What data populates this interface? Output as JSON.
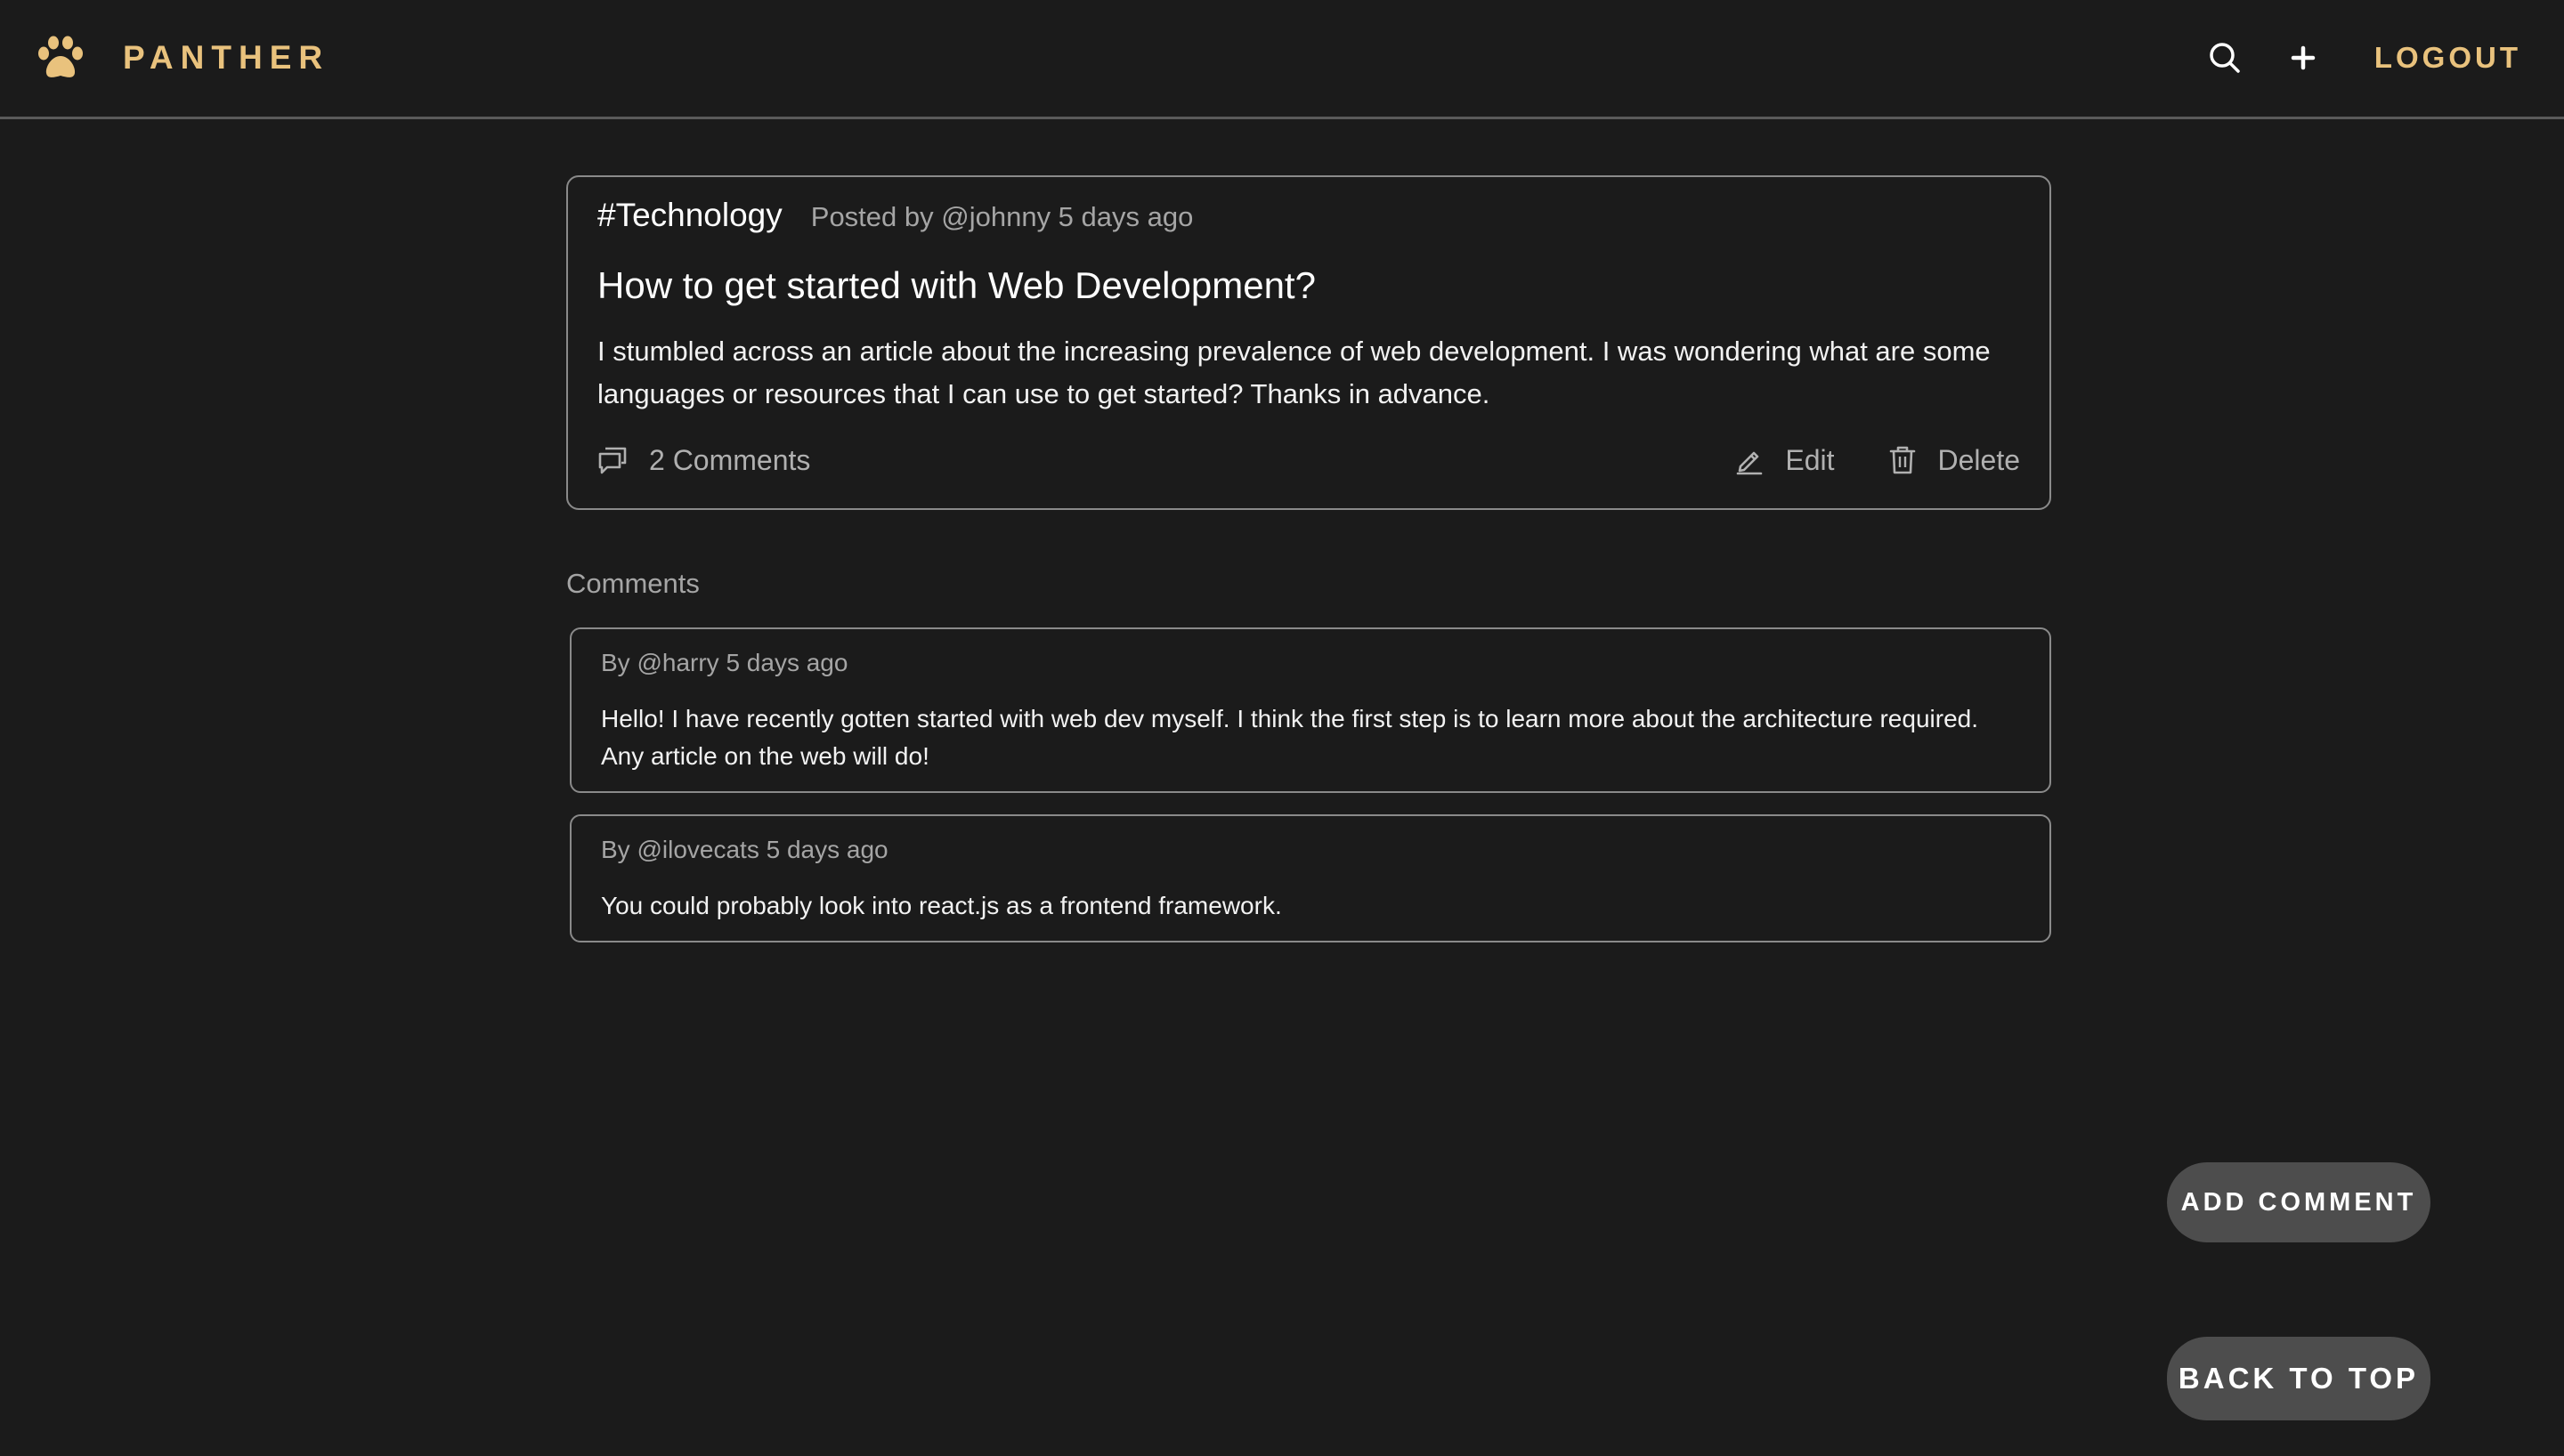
{
  "header": {
    "brand": "PANTHER",
    "logout_label": "LOGOUT",
    "accent_color": "#e9c27d",
    "icons": [
      "paw-icon",
      "search-icon",
      "plus-icon"
    ]
  },
  "post": {
    "tag": "#Technology",
    "posted_by": "Posted by @johnny 5 days ago",
    "title": "How to get started with Web Development?",
    "body": "I stumbled across an article about the increasing prevalence of web development. I was wondering what are some languages or resources that I can use to get started? Thanks in advance.",
    "comments_label": "2 Comments",
    "edit_label": "Edit",
    "delete_label": "Delete",
    "icons": [
      "comment-icon",
      "edit-icon",
      "trash-icon"
    ]
  },
  "comments_section": {
    "heading": "Comments",
    "items": [
      {
        "by": "By @harry 5 days ago",
        "text": "Hello! I have recently gotten started with web dev myself. I think the first step is to learn more about the architecture required. Any article on the web will do!"
      },
      {
        "by": "By @ilovecats 5 days ago",
        "text": "You could probably look into react.js as a frontend framework."
      }
    ]
  },
  "floating_buttons": {
    "add_comment": "ADD COMMENT",
    "back_to_top": "BACK TO TOP"
  },
  "colors": {
    "background": "#1b1b1b",
    "card_border": "#8a8a8a",
    "muted_text": "#a5a5a5",
    "button_bg": "#4d4d4d"
  }
}
